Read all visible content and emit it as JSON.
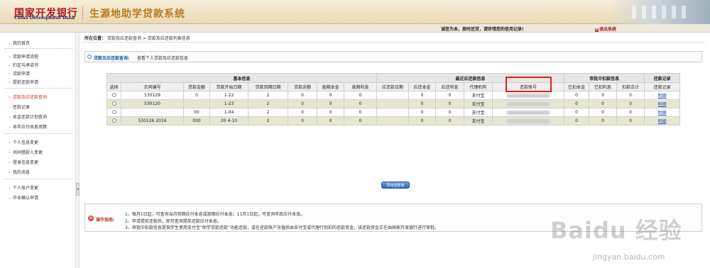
{
  "header": {
    "logo_cn": "国家开发银行",
    "logo_en": "China Development Bank",
    "system_title": "生源地助学贷款系统",
    "motto": "诚信为本，按时还贷，请珍惜您的信用记录!",
    "logout": "退出系统"
  },
  "sidebar": {
    "items": [
      {
        "label": "我的首页"
      },
      {
        "label": "贷款申请流程"
      },
      {
        "label": "约定与承诺书"
      },
      {
        "label": "贷款申请"
      },
      {
        "label": "提前还款申请"
      },
      {
        "label": "贷款及应还款查询"
      },
      {
        "label": "还款记录"
      },
      {
        "label": "本金还款计划查询"
      },
      {
        "label": "本年应付本息测算"
      },
      {
        "label": "个人信息变更"
      },
      {
        "label": "共同借款人变更"
      },
      {
        "label": "登录信息变更"
      },
      {
        "label": "我的消息"
      },
      {
        "label": "个人账户变更"
      },
      {
        "label": "毕业确认申请"
      }
    ],
    "active_index": 5
  },
  "breadcrumb": {
    "prefix": "所在位置：",
    "path": "贷款及应还款查询 > 贷款及应还款列表信息"
  },
  "query": {
    "title": "贷款及应还款查询:",
    "description": "查看个人贷款及应还款信息"
  },
  "table": {
    "groups": [
      "基本信息",
      "最近应还款信息",
      "审批中扣款信息",
      "还款记录"
    ],
    "columns": [
      "选择",
      "合同编号",
      "贷款金额",
      "贷款开始日期",
      "贷款到期日期",
      "贷款余额",
      "逾期本金",
      "逾期利息",
      "应还款日期",
      "应还本金",
      "应还利息",
      "代理机构",
      "还款账号",
      "已扣本金",
      "已扣利息",
      "扣款合计",
      "还款记录"
    ],
    "rows": [
      {
        "contract": "530129",
        "amount": "0",
        "start": "1-22",
        "end": "2",
        "balance": "0",
        "over_principal": "0",
        "over_interest": "0",
        "due_date": "",
        "due_principal": "0",
        "due_interest": "0",
        "agency": "支付宝",
        "account": "",
        "ded_principal": "0",
        "ded_interest": "0",
        "ded_total": "0",
        "record": "明细"
      },
      {
        "contract": "530120",
        "amount": "",
        "start": "1-23",
        "end": "2",
        "balance": "0",
        "over_principal": "0",
        "over_interest": "0",
        "due_date": "",
        "due_principal": "0",
        "due_interest": "0",
        "agency": "支付宝",
        "account": "",
        "ded_principal": "0",
        "ded_interest": "0",
        "ded_total": "0",
        "record": "明细"
      },
      {
        "contract": "",
        "amount": "00",
        "start": "1-04",
        "end": "2",
        "balance": "0",
        "over_principal": "0",
        "over_interest": "0",
        "due_date": "",
        "due_principal": "0",
        "due_interest": "0",
        "agency": "支付宝",
        "account": "",
        "ded_principal": "0",
        "ded_interest": "0",
        "ded_total": "0",
        "record": "明细"
      },
      {
        "contract": "530126 2016",
        "amount": "000",
        "start": "20 4-10",
        "end": "2",
        "balance": "0",
        "over_principal": "0",
        "over_interest": "0",
        "due_date": "",
        "due_principal": "0",
        "due_interest": "0",
        "agency": "支付宝",
        "account": "",
        "ded_principal": "0",
        "ded_interest": "0",
        "ded_total": "0",
        "record": "明细"
      }
    ]
  },
  "export_button": "导出还款单",
  "guide": {
    "title": "操作指南:",
    "lines": [
      "1、每月1日起，可查询当月到期应付本息或逾期应付本息；11月1日起，可查询年底应付本息。",
      "2、申请提前还款后，即可查询提前还款应付本息。",
      "3、审批中扣款信息是指学生使用支付宝“助学贷款还款”功能还款，或在还款账户充值后由支付宝或代理行划扣的还款资金，该还款资金正在由国家开发银行进行审批。"
    ]
  },
  "watermark": {
    "logo": "Baidu 经验",
    "url": "jingyan.baidu.com"
  },
  "colors": {
    "accent_red": "#c0392b",
    "link_blue": "#1d4fb0",
    "highlight_red": "#e0201f",
    "row_alt": "#e7e6d2"
  }
}
